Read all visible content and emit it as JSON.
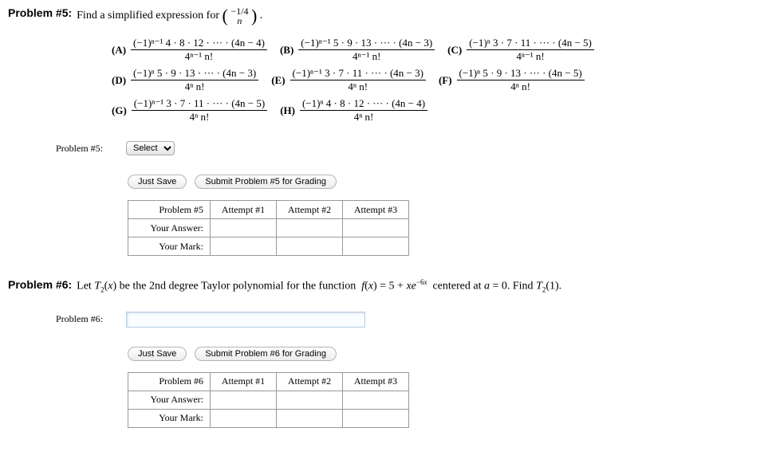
{
  "p5": {
    "title": "Problem #5:",
    "prompt_pre": "Find a simplified expression for ",
    "binom_top": "−1/4",
    "binom_bot": "n",
    "prompt_post": " .",
    "choices": {
      "A": {
        "label": "(A)",
        "num": "(−1)ⁿ⁻¹ 4 · 8 · 12 · ··· · (4n − 4)",
        "den": "4ⁿ⁻¹ n!"
      },
      "B": {
        "label": "(B)",
        "num": "(−1)ⁿ⁻¹ 5 · 9 · 13 · ··· · (4n − 3)",
        "den": "4ⁿ⁻¹ n!"
      },
      "C": {
        "label": "(C)",
        "num": "(−1)ⁿ 3 · 7 · 11 · ··· · (4n − 5)",
        "den": "4ⁿ⁻¹ n!"
      },
      "D": {
        "label": "(D)",
        "num": "(−1)ⁿ 5 · 9 · 13 · ··· · (4n − 3)",
        "den": "4ⁿ n!"
      },
      "E": {
        "label": "(E)",
        "num": "(−1)ⁿ⁻¹ 3 · 7 · 11 · ··· · (4n − 3)",
        "den": "4ⁿ n!"
      },
      "F": {
        "label": "(F)",
        "num": "(−1)ⁿ 5 · 9 · 13 · ··· · (4n − 5)",
        "den": "4ⁿ n!"
      },
      "G": {
        "label": "(G)",
        "num": "(−1)ⁿ⁻¹ 3 · 7 · 11 · ··· · (4n − 5)",
        "den": "4ⁿ n!"
      },
      "H": {
        "label": "(H)",
        "num": "(−1)ⁿ 4 · 8 · 12 · ··· · (4n − 4)",
        "den": "4ⁿ n!"
      }
    },
    "answer_label": "Problem #5:",
    "select_placeholder": "Select",
    "save_btn": "Just Save",
    "submit_btn": "Submit Problem #5 for Grading",
    "table_header": "Problem #5",
    "your_answer": "Your Answer:",
    "your_mark": "Your Mark:",
    "attempts": [
      "Attempt #1",
      "Attempt #2",
      "Attempt #3"
    ]
  },
  "p6": {
    "title": "Problem #6:",
    "prompt": "Let T₂(x) be the 2nd degree Taylor polynomial for the function  f(x) = 5 + xe⁻⁶ˣ  centered at a = 0. Find T₂(1).",
    "answer_label": "Problem #6:",
    "save_btn": "Just Save",
    "submit_btn": "Submit Problem #6 for Grading",
    "table_header": "Problem #6",
    "your_answer": "Your Answer:",
    "your_mark": "Your Mark:",
    "attempts": [
      "Attempt #1",
      "Attempt #2",
      "Attempt #3"
    ]
  }
}
